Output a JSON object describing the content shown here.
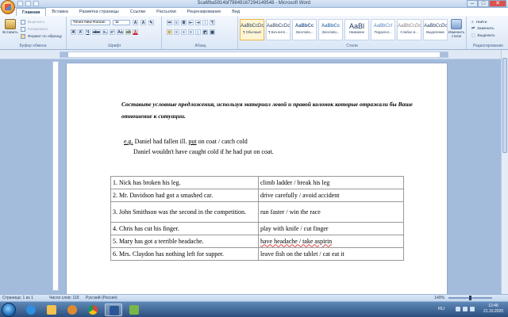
{
  "window": {
    "title": "5ca6fba5914bf79849167294149548 - Microsoft Word",
    "controls": [
      "–",
      "□",
      "✕"
    ]
  },
  "tabs": [
    "Главная",
    "Вставка",
    "Разметка страницы",
    "Ссылки",
    "Рассылки",
    "Рецензирование",
    "Вид"
  ],
  "ribbon": {
    "clipboard": {
      "label": "Буфер обмена",
      "paste": "Вставить",
      "cut": "Вырезать",
      "copy": "Копировать",
      "format_painter": "Формат по образцу"
    },
    "font": {
      "label": "Шрифт",
      "font_name": "Times New Roman",
      "font_size": "11",
      "buttons": [
        "Ж",
        "К",
        "Ч",
        "abc",
        "x₂",
        "x²",
        "Aa",
        "A"
      ]
    },
    "paragraph": {
      "label": "Абзац"
    },
    "styles": {
      "label": "Стили",
      "items": [
        {
          "sample": "AaBbCcDc",
          "name": "¶ Обычный",
          "selected": true
        },
        {
          "sample": "AaBbCcDc",
          "name": "¶ Без инте...",
          "selected": false
        },
        {
          "sample": "AaBbCc",
          "name": "Заголово...",
          "selected": false
        },
        {
          "sample": "AaBbCc",
          "name": "Заголово...",
          "selected": false
        },
        {
          "sample": "AaBl",
          "name": "Название",
          "selected": false
        },
        {
          "sample": "AaBbCcI",
          "name": "Подзагол...",
          "selected": false
        },
        {
          "sample": "AaBbCcDc",
          "name": "Слабое в...",
          "selected": false
        },
        {
          "sample": "AaBbCcDc",
          "name": "Выделение",
          "selected": false
        }
      ],
      "change_styles": "Изменить стили"
    },
    "editing": {
      "label": "Редактирование",
      "find": "Найти",
      "replace": "Заменить",
      "select": "Выделить"
    }
  },
  "document": {
    "instruction": "Составьте условные предложения, используя материал левой и правой колонок которые отражали бы Ваше отношение к ситуации.",
    "example_prefix": "e.g.",
    "example_text": " Daniel had fallen ill.  ",
    "example_underlined": "put",
    "example_rest": " on coat / catch cold",
    "example_answer": "Daniel wouldn't have caught cold if he had put on coat.",
    "table": [
      {
        "left": "1. Nick has broken his leg.",
        "right": "climb ladder / break his leg"
      },
      {
        "left": "2. Mr. Davidson had got a smashed car.",
        "right": "drive carefully / avoid accident"
      },
      {
        "left": "3. John Smithson was the second in the competition.",
        "right": "run faster / win the race"
      },
      {
        "left": "4. Chris has cut his finger.",
        "right": "play with knife / cut finger"
      },
      {
        "left": "5. Mary has got a terrible headache.",
        "right": "have headache / take aspirin"
      },
      {
        "left": "6. Mrs. Claydon has nothing left for supper.",
        "right": "leave fish on the tablet / cat eat it"
      }
    ]
  },
  "statusbar": {
    "page": "Страница: 1 из 1",
    "words": "Число слов: 119",
    "language": "Русский (Россия)",
    "zoom": "140%"
  },
  "taskbar": {
    "lang": "RU",
    "time": "12:46",
    "date": "21.10.2020"
  }
}
